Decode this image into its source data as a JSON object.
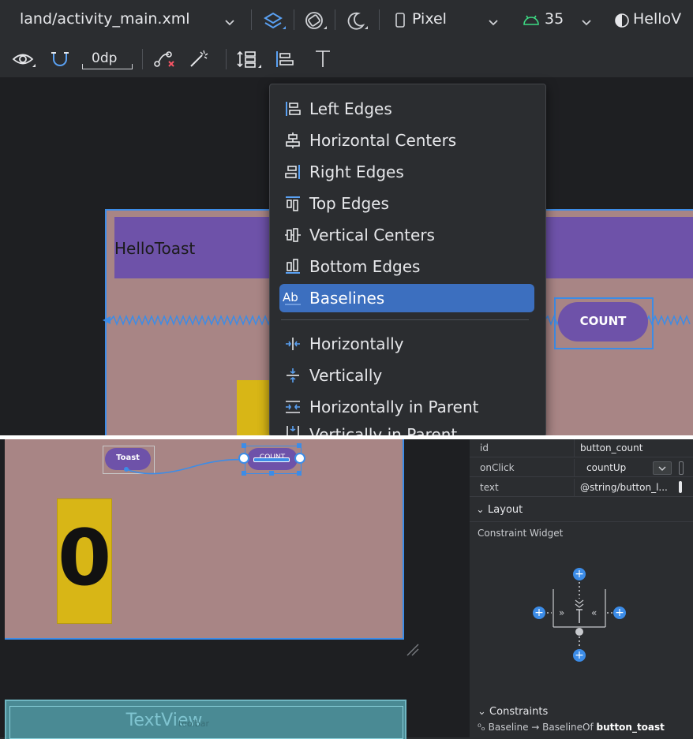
{
  "top_toolbar": {
    "file_name": "land/activity_main.xml",
    "device": "Pixel",
    "api_level": "35",
    "theme": "HelloV"
  },
  "secondary_toolbar": {
    "margin_value": "0dp"
  },
  "align_menu": {
    "items": [
      {
        "label": "Left Edges",
        "icon": "align-left-edges-icon"
      },
      {
        "label": "Horizontal Centers",
        "icon": "align-horizontal-centers-icon"
      },
      {
        "label": "Right Edges",
        "icon": "align-right-edges-icon"
      },
      {
        "label": "Top Edges",
        "icon": "align-top-edges-icon"
      },
      {
        "label": "Vertical Centers",
        "icon": "align-vertical-centers-icon"
      },
      {
        "label": "Bottom Edges",
        "icon": "align-bottom-edges-icon"
      },
      {
        "label": "Baselines",
        "icon": "align-baselines-icon",
        "selected": true
      },
      {
        "label": "Horizontally",
        "icon": "center-horizontally-icon"
      },
      {
        "label": "Vertically",
        "icon": "center-vertically-icon"
      },
      {
        "label": "Horizontally in Parent",
        "icon": "center-horizontally-parent-icon"
      },
      {
        "label": "Vertically in Parent",
        "icon": "center-vertically-parent-icon"
      }
    ],
    "selected_color": "#3c6fbf"
  },
  "design_canvas": {
    "app_title": "HelloToast",
    "count_button_label": "COUNT",
    "toast_button_label": "Toast",
    "count_value": "0",
    "textview_label": "TextView",
    "toolbar_label": "toolbar",
    "colors": {
      "screen_bg": "#a88585",
      "app_bar": "#6e52a9",
      "button": "#6e52a9",
      "count_box": "#d8b616",
      "selection": "#3c8ce7",
      "textview_bg": "#4a8a94"
    }
  },
  "attributes_panel": {
    "rows": [
      {
        "key": "id",
        "value": "button_count"
      },
      {
        "key": "onClick",
        "value": "countUp"
      },
      {
        "key": "text",
        "value": "@string/button_l..."
      }
    ],
    "layout_section": "Layout",
    "widget_title": "Constraint Widget",
    "constraints_section": "Constraints",
    "constraint_prefix": "Baseline → BaselineOf",
    "constraint_target": "button_toast"
  }
}
